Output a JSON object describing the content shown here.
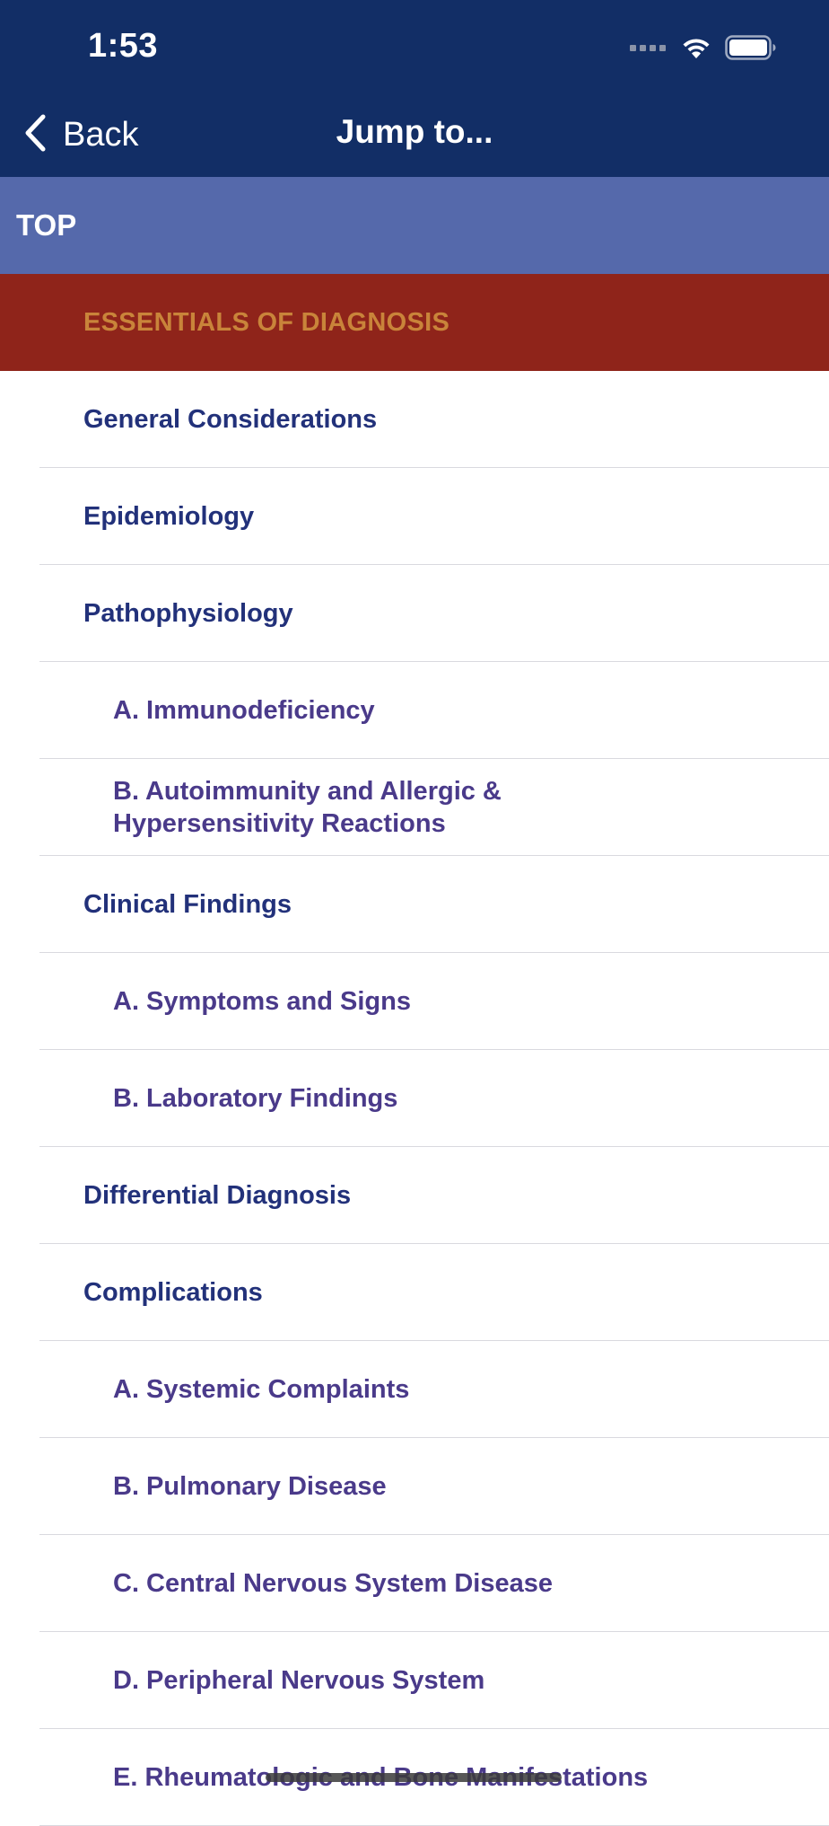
{
  "status_bar": {
    "time": "1:53"
  },
  "nav": {
    "back_label": "Back",
    "title": "Jump to..."
  },
  "top_label": "TOP",
  "essentials_label": "ESSENTIALS OF DIAGNOSIS",
  "items": [
    {
      "label": "General Considerations",
      "level": 1
    },
    {
      "label": "Epidemiology",
      "level": 1
    },
    {
      "label": "Pathophysiology",
      "level": 1
    },
    {
      "label": "A. Immunodeficiency",
      "level": 2
    },
    {
      "label": "B. Autoimmunity and Allergic & Hypersensitivity Reactions",
      "level": 2
    },
    {
      "label": "Clinical Findings",
      "level": 1
    },
    {
      "label": "A. Symptoms and Signs",
      "level": 2
    },
    {
      "label": "B. Laboratory Findings",
      "level": 2
    },
    {
      "label": "Differential Diagnosis",
      "level": 1
    },
    {
      "label": "Complications",
      "level": 1
    },
    {
      "label": "A. Systemic Complaints",
      "level": 2
    },
    {
      "label": "B. Pulmonary Disease",
      "level": 2
    },
    {
      "label": "C. Central Nervous System Disease",
      "level": 2
    },
    {
      "label": "D. Peripheral Nervous System",
      "level": 2
    },
    {
      "label": "E. Rheumatologic and Bone Manifestations",
      "level": 2
    }
  ],
  "colors": {
    "header_bg": "#122e66",
    "top_bar_bg": "#5569ab",
    "essentials_bg": "#8f241a",
    "essentials_text": "#c9843a",
    "level1_text": "#22317a",
    "level2_text": "#4a3a8a"
  },
  "icons": {
    "back": "chevron-left-icon",
    "wifi": "wifi-icon",
    "battery": "battery-icon",
    "cellular": "cellular-signal-icon"
  }
}
